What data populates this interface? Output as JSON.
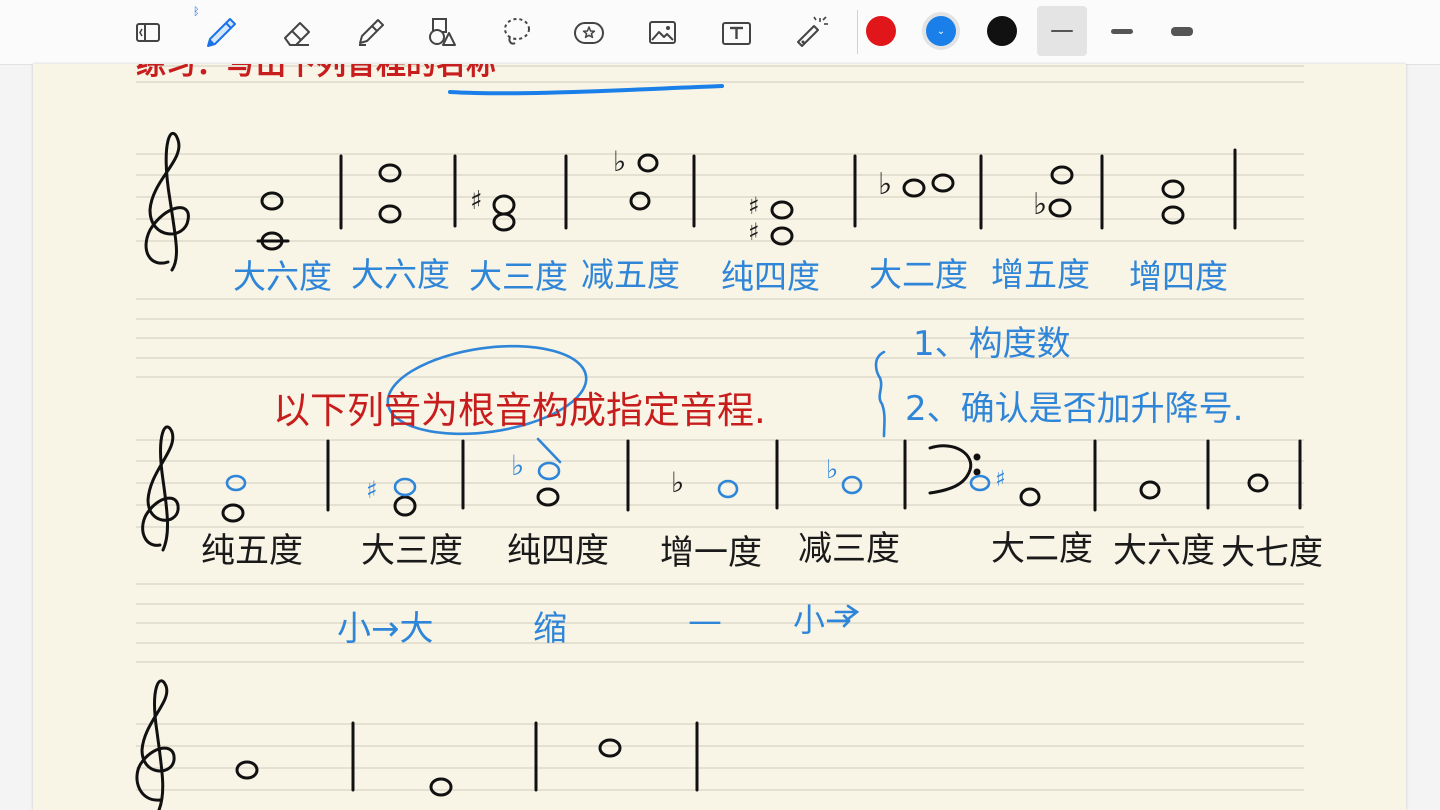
{
  "toolbar": {
    "tools": [
      {
        "name": "sidebar-toggle",
        "icon": "sidebar-icon"
      },
      {
        "name": "pen",
        "icon": "pen-icon",
        "active": true
      },
      {
        "name": "eraser",
        "icon": "eraser-icon"
      },
      {
        "name": "highlighter",
        "icon": "highlighter-icon"
      },
      {
        "name": "shapes",
        "icon": "shapes-icon"
      },
      {
        "name": "lasso",
        "icon": "lasso-icon"
      },
      {
        "name": "sticker",
        "icon": "sticker-icon"
      },
      {
        "name": "image",
        "icon": "image-icon"
      },
      {
        "name": "text",
        "icon": "text-icon"
      },
      {
        "name": "laser-pointer",
        "icon": "laser-pointer-icon"
      }
    ],
    "bluetooth_icon": "bluetooth-icon",
    "colors": [
      {
        "name": "red",
        "hex": "#e0161b"
      },
      {
        "name": "blue",
        "hex": "#1a7fe8",
        "selected": true
      },
      {
        "name": "black",
        "hex": "#111111"
      }
    ],
    "stroke_widths": [
      "thin",
      "medium",
      "thick"
    ],
    "selected_width": "thin"
  },
  "notes": {
    "title_fragment": "练习：写出下列音程的名称",
    "row1_labels": [
      "大六度",
      "大六度",
      "大三度",
      "减五度",
      "纯四度",
      "大二度",
      "增五度",
      "增四度"
    ],
    "task_instruction": "以下列音为根音构成指定音程.",
    "steps": [
      "1、构度数",
      "2、确认是否加升降号."
    ],
    "row2_labels": [
      "纯五度",
      "大三度",
      "纯四度",
      "增一度",
      "减三度",
      "大二度",
      "大六度",
      "大七度"
    ],
    "mnemonic": [
      "小→大",
      "缩",
      "—",
      "小→"
    ],
    "accidentals": {
      "sharp": "♯",
      "flat": "♭",
      "treble_clef": "𝄞",
      "bass_clef": "𝄢",
      "natural_note": "o",
      "double_accidental": "b o o",
      "flat_flat": "bo"
    }
  }
}
